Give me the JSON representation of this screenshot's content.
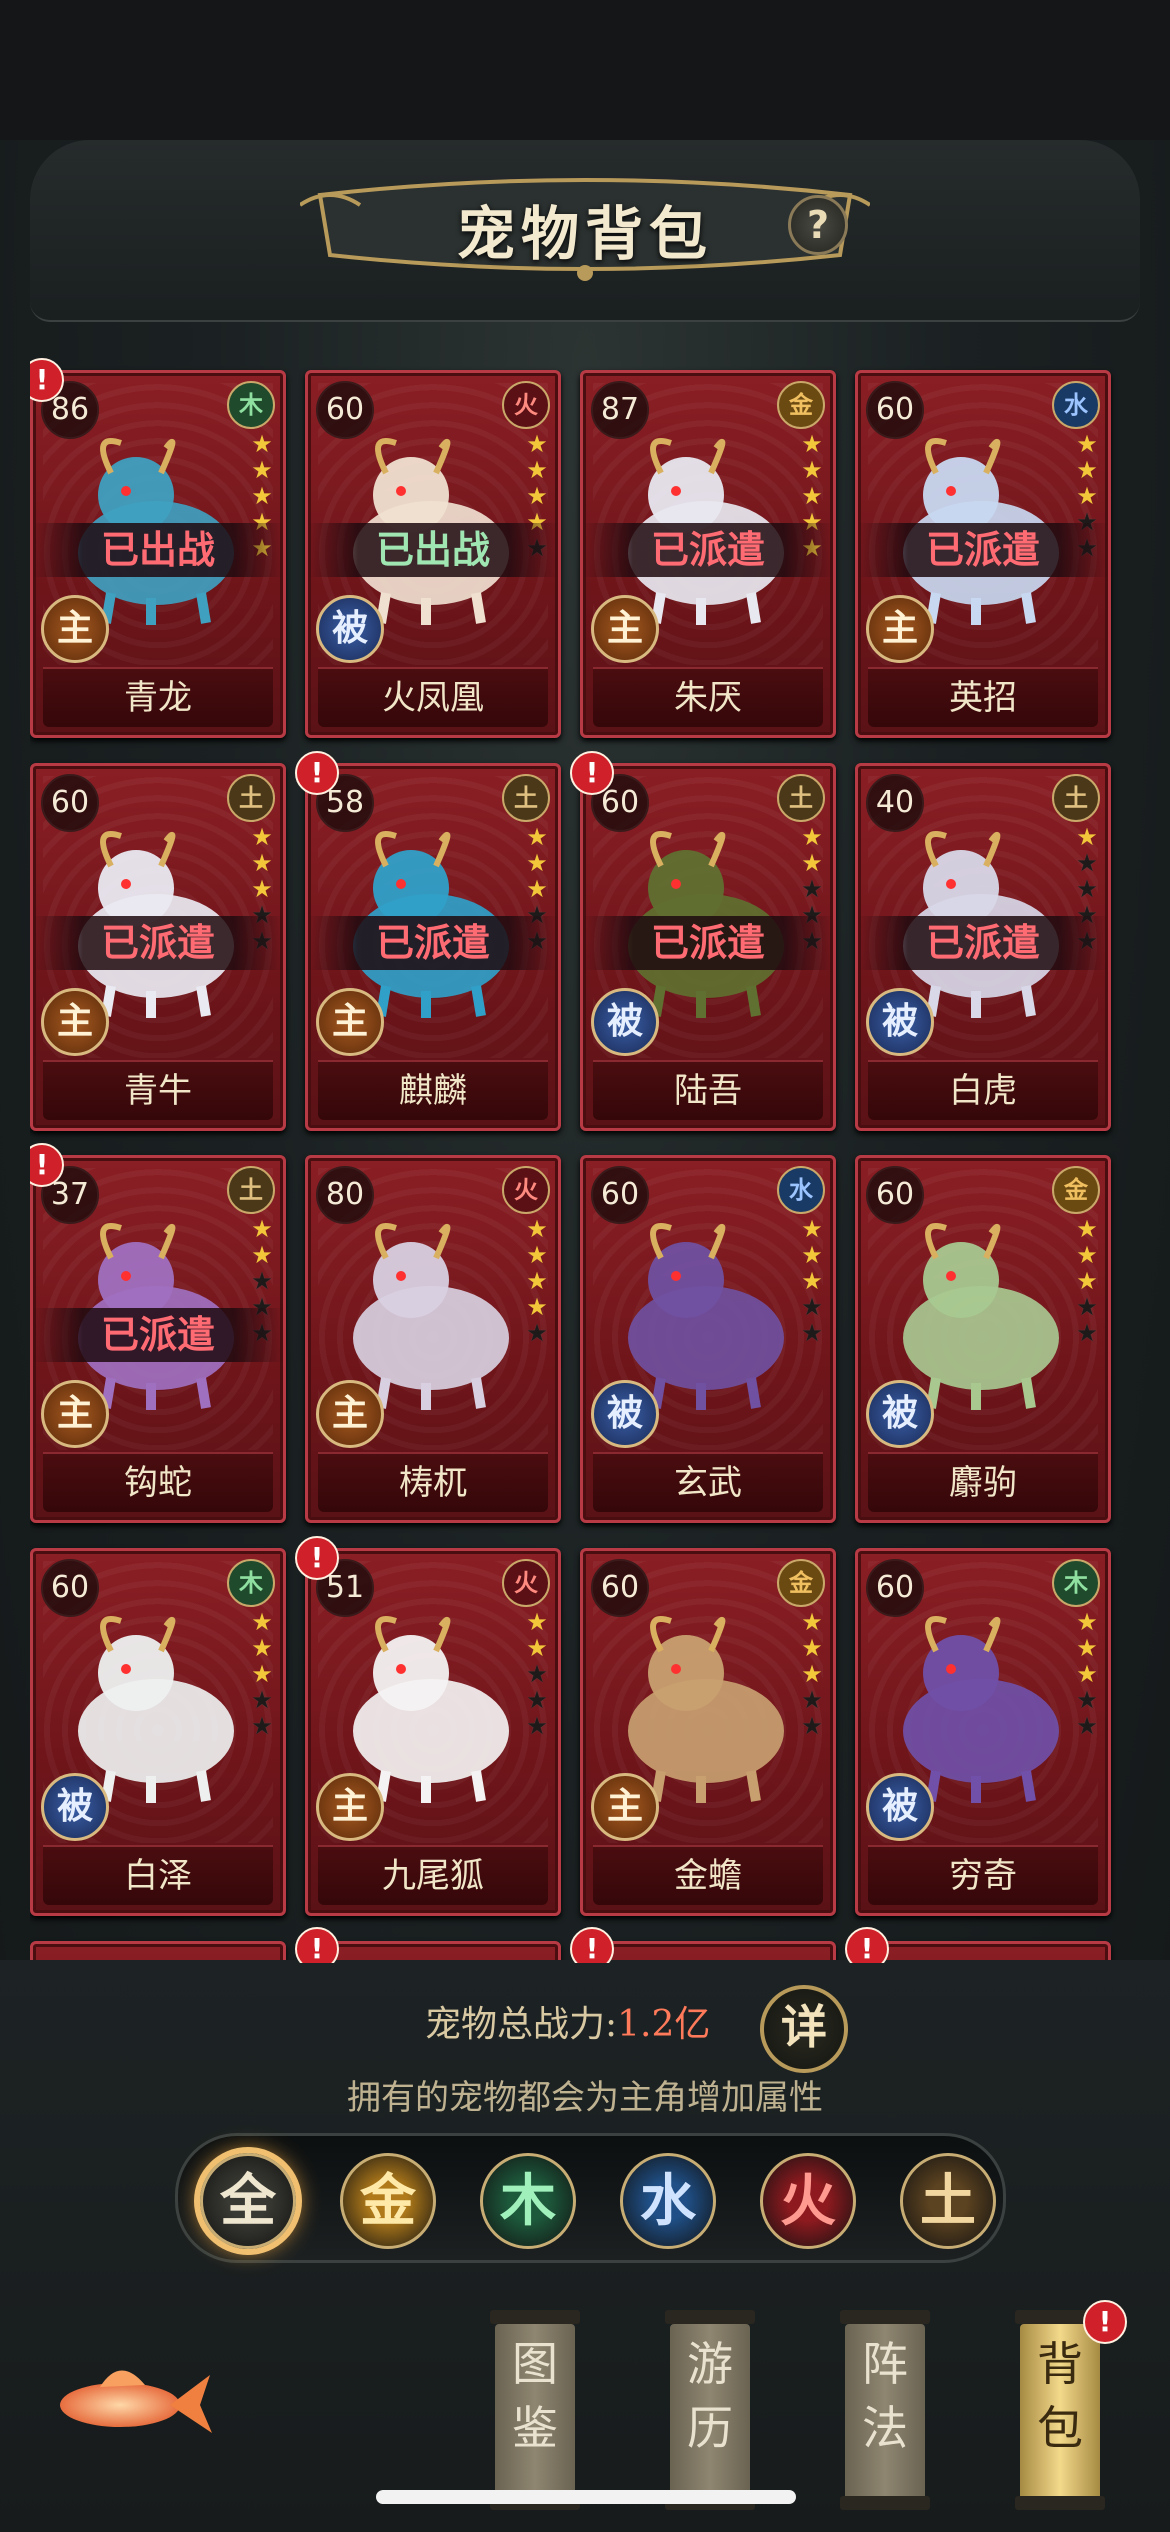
{
  "header": {
    "title": "宠物背包",
    "help_icon": "?"
  },
  "pets": [
    {
      "level": "86",
      "element": "木",
      "name": "青龙",
      "status": "已出战",
      "status_style": "battle-red",
      "role": "主",
      "stars": 5,
      "alert": true
    },
    {
      "level": "60",
      "element": "火",
      "name": "火凤凰",
      "status": "已出战",
      "status_style": "battle-green",
      "role": "被",
      "stars": 4,
      "alert": false
    },
    {
      "level": "87",
      "element": "金",
      "name": "朱厌",
      "status": "已派遣",
      "status_style": "deployed",
      "role": "主",
      "stars": 5,
      "alert": false
    },
    {
      "level": "60",
      "element": "水",
      "name": "英招",
      "status": "已派遣",
      "status_style": "deployed",
      "role": "主",
      "stars": 3,
      "alert": false
    },
    {
      "level": "60",
      "element": "土",
      "name": "青牛",
      "status": "已派遣",
      "status_style": "deployed",
      "role": "主",
      "stars": 3,
      "alert": false
    },
    {
      "level": "58",
      "element": "土",
      "name": "麒麟",
      "status": "已派遣",
      "status_style": "deployed",
      "role": "主",
      "stars": 3,
      "alert": true
    },
    {
      "level": "60",
      "element": "土",
      "name": "陆吾",
      "status": "已派遣",
      "status_style": "deployed",
      "role": "被",
      "stars": 2,
      "alert": true
    },
    {
      "level": "40",
      "element": "土",
      "name": "白虎",
      "status": "已派遣",
      "status_style": "deployed",
      "role": "被",
      "stars": 1,
      "alert": false
    },
    {
      "level": "37",
      "element": "土",
      "name": "钩蛇",
      "status": "已派遣",
      "status_style": "deployed",
      "role": "主",
      "stars": 2,
      "alert": true
    },
    {
      "level": "80",
      "element": "火",
      "name": "梼杌",
      "status": "",
      "status_style": "",
      "role": "主",
      "stars": 4,
      "alert": false
    },
    {
      "level": "60",
      "element": "水",
      "name": "玄武",
      "status": "",
      "status_style": "",
      "role": "被",
      "stars": 3,
      "alert": false
    },
    {
      "level": "60",
      "element": "金",
      "name": "麝驹",
      "status": "",
      "status_style": "",
      "role": "被",
      "stars": 3,
      "alert": false
    },
    {
      "level": "60",
      "element": "木",
      "name": "白泽",
      "status": "",
      "status_style": "",
      "role": "被",
      "stars": 3,
      "alert": false
    },
    {
      "level": "51",
      "element": "火",
      "name": "九尾狐",
      "status": "",
      "status_style": "",
      "role": "主",
      "stars": 2,
      "alert": true
    },
    {
      "level": "60",
      "element": "金",
      "name": "金蟾",
      "status": "",
      "status_style": "",
      "role": "主",
      "stars": 3,
      "alert": false
    },
    {
      "level": "60",
      "element": "木",
      "name": "穷奇",
      "status": "",
      "status_style": "",
      "role": "被",
      "stars": 3,
      "alert": false
    }
  ],
  "power": {
    "label": "宠物总战力:",
    "value": "1.2亿",
    "detail_button": "详"
  },
  "subtitle": "拥有的宠物都会为主角增加属性",
  "filters": [
    "全",
    "金",
    "木",
    "水",
    "火",
    "土"
  ],
  "selected_filter": "全",
  "nav": [
    {
      "label": "图鉴",
      "active": false
    },
    {
      "label": "游历",
      "active": false
    },
    {
      "label": "阵法",
      "active": false
    },
    {
      "label": "背包",
      "active": true,
      "alert": true
    }
  ],
  "colors": {
    "金": "#d9a441",
    "木": "#2f7a4a",
    "水": "#2a5fa0",
    "火": "#a8262a",
    "土": "#7a5a2a"
  }
}
